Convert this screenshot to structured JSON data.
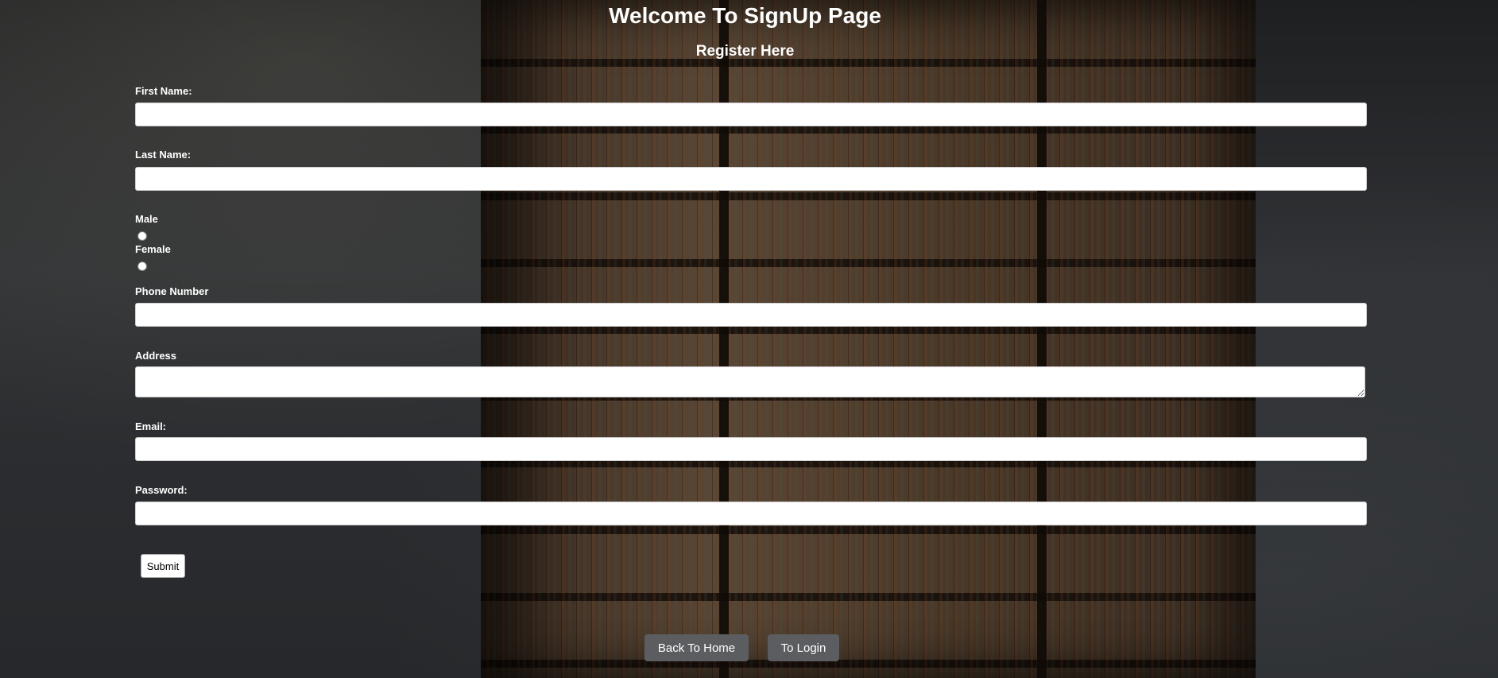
{
  "header": {
    "title": "Welcome To SignUp Page",
    "subtitle": "Register Here"
  },
  "form": {
    "first_name_label": "First Name:",
    "first_name_value": "",
    "last_name_label": "Last Name:",
    "last_name_value": "",
    "gender_male_label": "Male",
    "gender_female_label": "Female",
    "phone_label": "Phone Number",
    "phone_value": "",
    "address_label": "Address",
    "address_value": "",
    "email_label": "Email:",
    "email_value": "",
    "password_label": "Password:",
    "password_value": "",
    "submit_label": "Submit"
  },
  "nav": {
    "back_home_label": "Back To Home",
    "to_login_label": "To Login"
  },
  "colors": {
    "text": "#ffffff",
    "nav_button_bg": "#5c5d60",
    "input_bg": "#ffffff"
  }
}
